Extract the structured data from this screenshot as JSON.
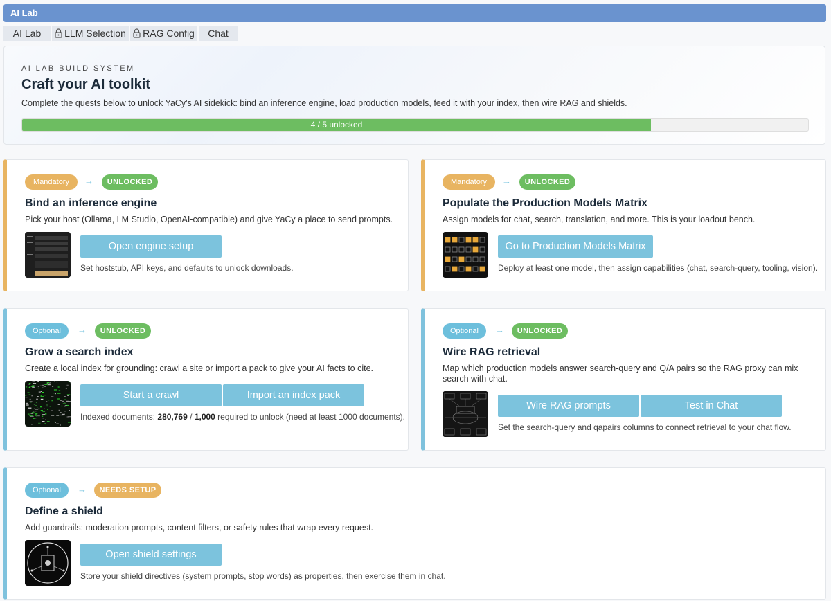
{
  "window": {
    "title": "AI Lab"
  },
  "tabs": [
    {
      "label": "AI Lab",
      "locked": false
    },
    {
      "label": "LLM Selection",
      "locked": true
    },
    {
      "label": "RAG Config",
      "locked": true
    },
    {
      "label": "Chat",
      "locked": false
    }
  ],
  "hero": {
    "eyebrow": "AI LAB BUILD SYSTEM",
    "title": "Craft your AI toolkit",
    "description": "Complete the quests below to unlock YaCy's AI sidekick: bind an inference engine, load production models, feed it with your index, then wire RAG and shields.",
    "progress_label": "4 / 5 unlocked",
    "progress_fraction": 0.8
  },
  "cards": [
    {
      "tier": "Mandatory",
      "status": "UNLOCKED",
      "title": "Bind an inference engine",
      "description": "Pick your host (Ollama, LM Studio, OpenAI-compatible) and give YaCy a place to send prompts.",
      "buttons": [
        "Open engine setup"
      ],
      "hint": "Set hoststub, API keys, and defaults to unlock downloads."
    },
    {
      "tier": "Mandatory",
      "status": "UNLOCKED",
      "title": "Populate the Production Models Matrix",
      "description": "Assign models for chat, search, translation, and more. This is your loadout bench.",
      "buttons": [
        "Go to Production Models Matrix"
      ],
      "hint": "Deploy at least one model, then assign capabilities (chat, search-query, tooling, vision)."
    },
    {
      "tier": "Optional",
      "status": "UNLOCKED",
      "title": "Grow a search index",
      "description": "Create a local index for grounding: crawl a site or import a pack to give your AI facts to cite.",
      "buttons": [
        "Start a crawl",
        "Import an index pack"
      ],
      "hint_prefix": "Indexed documents: ",
      "indexed_count": "280,769",
      "hint_sep": " / ",
      "required_count": "1,000",
      "hint_suffix": " required to unlock (need at least 1000 documents)."
    },
    {
      "tier": "Optional",
      "status": "UNLOCKED",
      "title": "Wire RAG retrieval",
      "description": "Map which production models answer search-query and Q/A pairs so the RAG proxy can mix search with chat.",
      "buttons": [
        "Wire RAG prompts",
        "Test in Chat"
      ],
      "hint": "Set the search-query and qapairs columns to connect retrieval to your chat flow."
    },
    {
      "tier": "Optional",
      "status": "NEEDS SETUP",
      "title": "Define a shield",
      "description": "Add guardrails: moderation prompts, content filters, or safety rules that wrap every request.",
      "buttons": [
        "Open shield settings"
      ],
      "hint": "Store your shield directives (system prompts, stop words) as properties, then exercise them in chat."
    }
  ],
  "arrow_glyph": "→",
  "colors": {
    "titlebar": "#6a93cf",
    "mandatory": "#e8b461",
    "optional": "#6dbfdc",
    "unlocked": "#6dbd61",
    "button": "#7cc3dd"
  }
}
